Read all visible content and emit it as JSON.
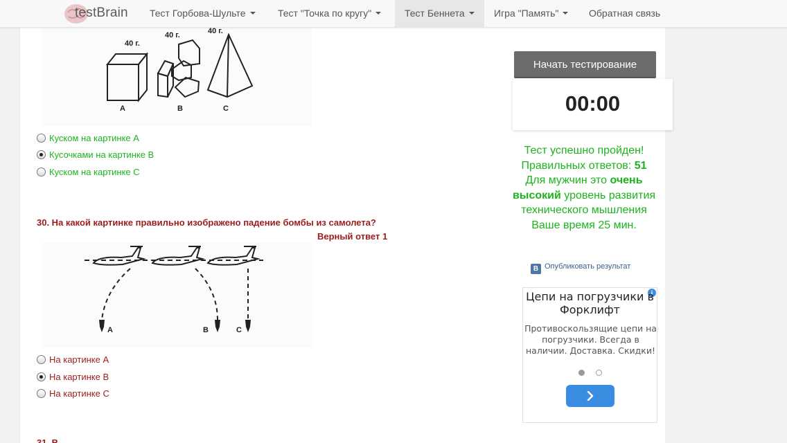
{
  "nav": {
    "logo_text": "testBrain",
    "items": [
      {
        "label": "Тест Горбова-Шульте",
        "caret": true
      },
      {
        "label": "Тест \"Точка по кругу\"",
        "caret": true
      },
      {
        "label": "Тест Беннета",
        "caret": true,
        "active": true
      },
      {
        "label": "Игра \"Память\"",
        "caret": true
      },
      {
        "label": "Обратная связь",
        "caret": false
      }
    ]
  },
  "q29": {
    "image_labels": {
      "w1": "40 г.",
      "w2": "40 г.",
      "w3": "40 г.",
      "a": "А",
      "b": "В",
      "c": "С"
    },
    "options": [
      {
        "label": "Куском на картинке А",
        "checked": false
      },
      {
        "label": "Кусочками на картинке В",
        "checked": true
      },
      {
        "label": "Куском на картинке С",
        "checked": false
      }
    ]
  },
  "q30": {
    "title": "30. На какой картинке правильно изображено падение бомбы из самолета?",
    "answer_note": "Верный ответ 1",
    "image_labels": {
      "a": "А",
      "b": "В",
      "c": "С"
    },
    "options": [
      {
        "label": "На картинке А",
        "checked": false
      },
      {
        "label": "На картинке В",
        "checked": true
      },
      {
        "label": "На картинке С",
        "checked": false
      }
    ]
  },
  "next_question_partial": "31. В",
  "sidebar": {
    "start_button": "Начать тестирование",
    "timer": "00:00",
    "result": {
      "line1": "Тест успешно пройден!",
      "line2_prefix": "Правильных ответов:",
      "correct": "51",
      "line3_prefix": "Для мужчин это",
      "level_bold": "очень высокий",
      "line3_suffix": "уровень развития технического мышления",
      "time_line": "Ваше время 25 мин."
    },
    "vk_icon": "В",
    "publish_label": "Опубликовать результат"
  },
  "ad": {
    "info_icon": "i",
    "title": "Цепи на погрузчики в Форклифт",
    "text": "Противоскользящие цепи на погрузчики. Всегда в наличии. Доставка. Скидки!"
  },
  "colors": {
    "accent_green": "#1db31d",
    "question_red": "#9c1c1c",
    "ad_blue": "#3a8de0"
  }
}
